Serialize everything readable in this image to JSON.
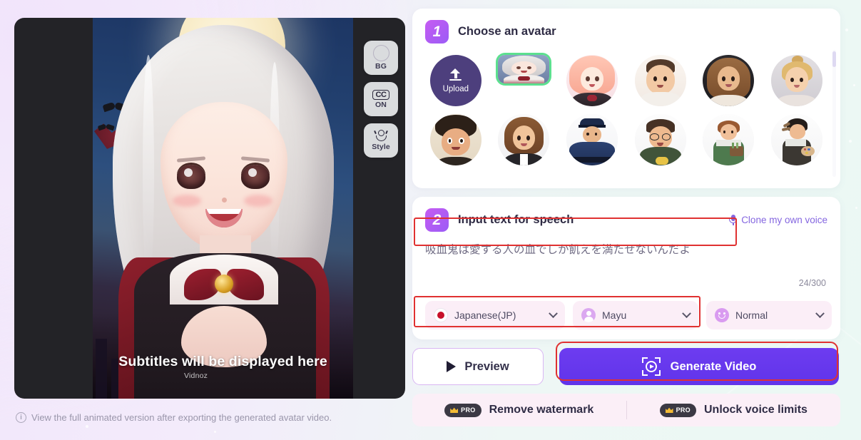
{
  "preview": {
    "subtitle_placeholder": "Subtitles will be displayed here",
    "watermark": "Vidnoz",
    "controls": [
      {
        "name": "bg",
        "label": "BG",
        "icon": "circle-icon"
      },
      {
        "name": "cc",
        "label": "ON",
        "icon": "cc-icon",
        "glyph": "CC"
      },
      {
        "name": "style",
        "label": "Style",
        "icon": "style-icon"
      }
    ],
    "note": "View the full animated version after exporting the generated avatar video.",
    "note_icon": "info-icon"
  },
  "step1": {
    "number": "1",
    "title": "Choose an avatar",
    "upload": {
      "label": "Upload",
      "icon": "upload-icon"
    },
    "avatars": [
      {
        "name": "anime-girl-white-hair",
        "selected": true
      },
      {
        "name": "anime-girl-pink-hair",
        "selected": false
      },
      {
        "name": "young-man-casual",
        "selected": false
      },
      {
        "name": "woman-long-brown-hair",
        "selected": false
      },
      {
        "name": "woman-blonde-bun",
        "selected": false
      },
      {
        "name": "curly-hair-boy",
        "selected": false
      },
      {
        "name": "businesswoman-suit",
        "selected": false
      },
      {
        "name": "police-officer",
        "selected": false
      },
      {
        "name": "man-glasses-green-jacket",
        "selected": false
      },
      {
        "name": "gardener-woman",
        "selected": false
      },
      {
        "name": "artist-woman-palette",
        "selected": false
      }
    ]
  },
  "step2": {
    "number": "2",
    "title": "Input text for speech",
    "clone_voice_label": "Clone my own voice",
    "clone_voice_icon": "microphone-icon",
    "speech_text": "吸血鬼は愛する人の血でしか飢えを満たせないんだよ",
    "speech_placeholder": "Input text for speech",
    "char_count": "24/300",
    "language_select": {
      "value": "Japanese(JP)",
      "icon": "flag-jp-icon"
    },
    "voice_select": {
      "value": "Mayu",
      "icon": "voice-avatar-icon"
    },
    "tone_select": {
      "value": "Normal",
      "icon": "emoji-smile-icon"
    }
  },
  "actions": {
    "preview_label": "Preview",
    "preview_icon": "play-icon",
    "generate_label": "Generate Video",
    "generate_icon": "video-capture-icon"
  },
  "pro_bar": {
    "badge_label": "PRO",
    "badge_icon": "crown-icon",
    "items": [
      {
        "label": "Remove watermark"
      },
      {
        "label": "Unlock voice limits"
      }
    ]
  },
  "colors": {
    "accent_purple": "#6134ea",
    "step_badge_gradient_start": "#c65cf2",
    "step_badge_gradient_end": "#9b5cf6",
    "selected_ring_green": "#5ce08f",
    "annotation_red": "#e03131",
    "select_pink": "#fbeef7",
    "link_purple": "#8466e0"
  }
}
